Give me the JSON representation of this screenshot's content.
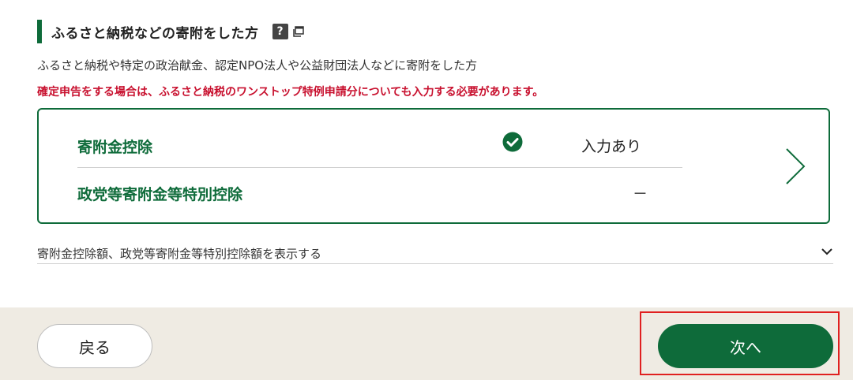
{
  "section": {
    "title": "ふるさと納税などの寄附をした方",
    "help_icon_text": "?",
    "description": "ふるさと納税や特定の政治献金、認定NPO法人や公益財団法人などに寄附をした方",
    "warning": "確定申告をする場合は、ふるさと納税のワンストップ特例申請分についても入力する必要があります。"
  },
  "card": {
    "rows": [
      {
        "label": "寄附金控除",
        "status": "入力あり",
        "icon": "check-circle-icon"
      },
      {
        "label": "政党等寄附金等特別控除",
        "status": "－"
      }
    ],
    "nav_icon": "chevron-right-icon"
  },
  "expander": {
    "label": "寄附金控除額、政党等寄附金等特別控除額を表示する",
    "icon": "chevron-down-icon"
  },
  "footer": {
    "back_label": "戻る",
    "next_label": "次へ"
  },
  "colors": {
    "primary_green": "#0e6b3a",
    "warning_red": "#c8102e",
    "footer_bg": "#efebe3",
    "highlight_red": "#e02020"
  }
}
